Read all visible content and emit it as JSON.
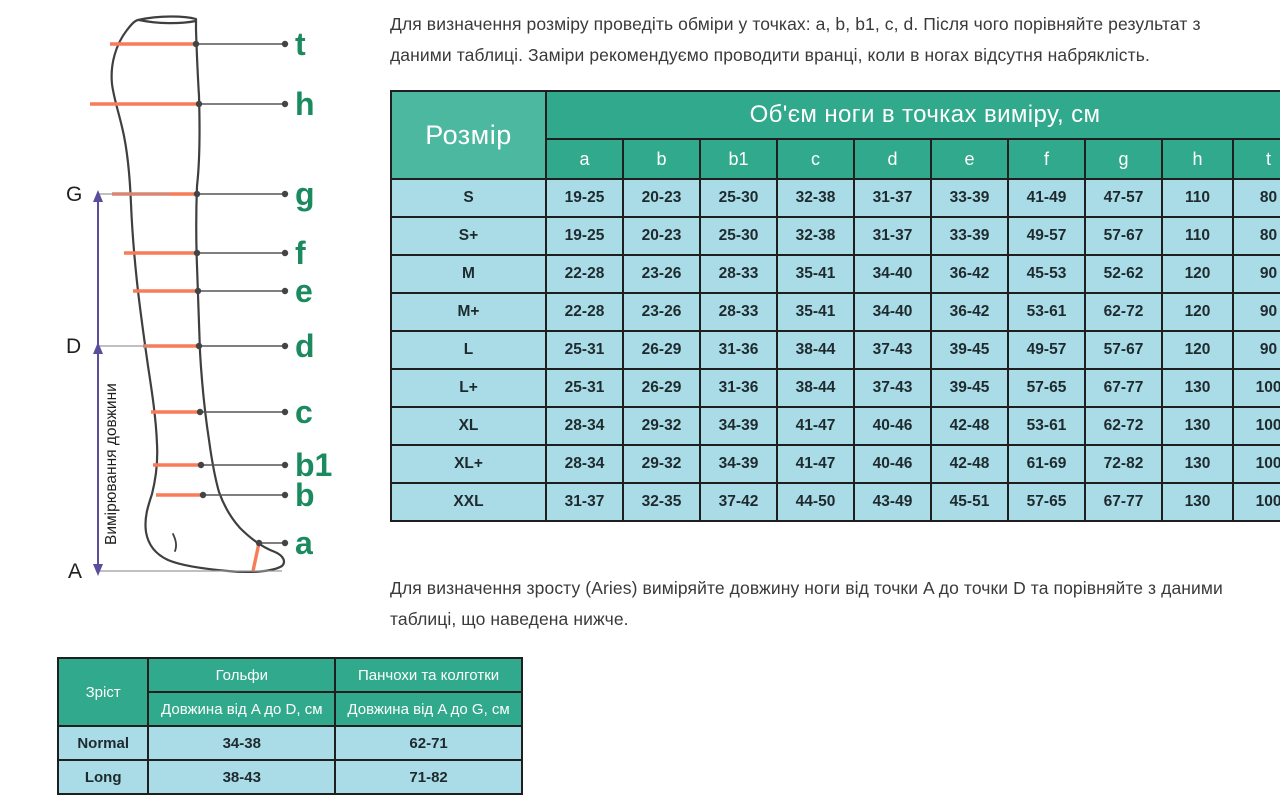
{
  "diagram": {
    "title": "leg-measurement-diagram",
    "vertical_axis_label": "Вимірювання довжини",
    "point_labels": [
      "t",
      "h",
      "g",
      "f",
      "e",
      "d",
      "c",
      "b1",
      "b",
      "a"
    ],
    "axis_markers": [
      "G",
      "D",
      "A"
    ],
    "colors": {
      "measure_line": "#f97c58",
      "label_text": "#1b8a5f",
      "outline": "#3f3f3f",
      "arrow": "#5a4e9c",
      "leader_line": "#555555"
    }
  },
  "intro_paragraph": "Для визначення розміру проведіть обміри у точках: a, b, b1, c, d. Після чого порівняйте результат з даними таблиці. Заміри рекомендуємо проводити вранці, коли в ногах відсутня набряклість.",
  "height_paragraph": "Для визначення зросту (Aries) виміряйте довжину ноги від точки A до точки D та порівняйте з даними таблиці, що наведена нижче.",
  "size_table": {
    "size_column_header": "Розмір",
    "group_header": "Об'єм ноги в точках виміру, см",
    "point_headers": [
      "a",
      "b",
      "b1",
      "c",
      "d",
      "e",
      "f",
      "g",
      "h",
      "t"
    ],
    "rows": [
      {
        "size": "S",
        "values": [
          "19-25",
          "20-23",
          "25-30",
          "32-38",
          "31-37",
          "33-39",
          "41-49",
          "47-57",
          "110",
          "80"
        ]
      },
      {
        "size": "S+",
        "values": [
          "19-25",
          "20-23",
          "25-30",
          "32-38",
          "31-37",
          "33-39",
          "49-57",
          "57-67",
          "110",
          "80"
        ]
      },
      {
        "size": "M",
        "values": [
          "22-28",
          "23-26",
          "28-33",
          "35-41",
          "34-40",
          "36-42",
          "45-53",
          "52-62",
          "120",
          "90"
        ]
      },
      {
        "size": "M+",
        "values": [
          "22-28",
          "23-26",
          "28-33",
          "35-41",
          "34-40",
          "36-42",
          "53-61",
          "62-72",
          "120",
          "90"
        ]
      },
      {
        "size": "L",
        "values": [
          "25-31",
          "26-29",
          "31-36",
          "38-44",
          "37-43",
          "39-45",
          "49-57",
          "57-67",
          "120",
          "90"
        ]
      },
      {
        "size": "L+",
        "values": [
          "25-31",
          "26-29",
          "31-36",
          "38-44",
          "37-43",
          "39-45",
          "57-65",
          "67-77",
          "130",
          "100"
        ]
      },
      {
        "size": "XL",
        "values": [
          "28-34",
          "29-32",
          "34-39",
          "41-47",
          "40-46",
          "42-48",
          "53-61",
          "62-72",
          "130",
          "100"
        ]
      },
      {
        "size": "XL+",
        "values": [
          "28-34",
          "29-32",
          "34-39",
          "41-47",
          "40-46",
          "42-48",
          "61-69",
          "72-82",
          "130",
          "100"
        ]
      },
      {
        "size": "XXL",
        "values": [
          "31-37",
          "32-35",
          "37-42",
          "44-50",
          "43-49",
          "45-51",
          "57-65",
          "67-77",
          "130",
          "100"
        ]
      }
    ]
  },
  "height_table": {
    "row_header": "Зріст",
    "group_headers": [
      "Гольфи",
      "Панчохи та колготки"
    ],
    "sub_headers": [
      "Довжина від A до D, см",
      "Довжина від A до G, см"
    ],
    "rows": [
      {
        "label": "Normal",
        "values": [
          "34-38",
          "62-71"
        ]
      },
      {
        "label": "Long",
        "values": [
          "38-43",
          "71-82"
        ]
      }
    ]
  },
  "colors": {
    "header_dark_green": "#31a98c",
    "header_mid_green": "#4cb89f",
    "body_light_blue": "#a9dce7",
    "border": "#1f1f1f",
    "text": "#3a3a3a"
  }
}
